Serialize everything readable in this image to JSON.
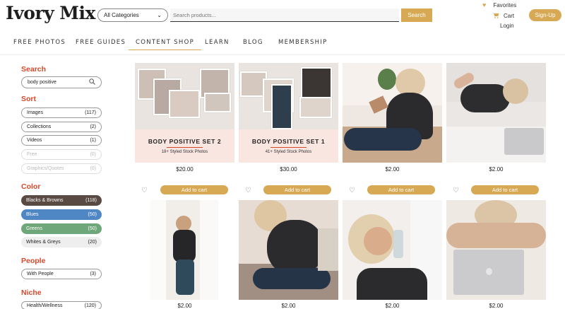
{
  "header": {
    "logo": "Ivory Mix",
    "category_select": "All Categories",
    "search_placeholder": "Search products...",
    "search_button": "Search",
    "favorites": "Favorites",
    "cart": "Cart",
    "login": "Login",
    "signup": "Sign-Up"
  },
  "nav": [
    "FREE PHOTOS",
    "FREE GUIDES",
    "CONTENT SHOP",
    "LEARN",
    "BLOG",
    "MEMBERSHIP"
  ],
  "sidebar": {
    "search_heading": "Search",
    "search_value": "body positive",
    "sort_heading": "Sort",
    "sort": [
      {
        "label": "Images",
        "count": "(117)"
      },
      {
        "label": "Collections",
        "count": "(2)"
      },
      {
        "label": "Videos",
        "count": "(1)"
      },
      {
        "label": "Free",
        "count": "(0)"
      },
      {
        "label": "Graphics/Quotes",
        "count": "(0)"
      }
    ],
    "color_heading": "Color",
    "colors": [
      {
        "label": "Blacks & Browns",
        "count": "(118)",
        "color": "#5a4a44"
      },
      {
        "label": "Blues",
        "count": "(50)",
        "color": "#4f86c4"
      },
      {
        "label": "Greens",
        "count": "(50)",
        "color": "#6ea779"
      },
      {
        "label": "Whites & Greys",
        "count": "(20)",
        "color": "#eeeeee"
      }
    ],
    "people_heading": "People",
    "people": [
      {
        "label": "With People",
        "count": "(3)"
      }
    ],
    "niche_heading": "Niche",
    "niche": [
      {
        "label": "Health/Wellness",
        "count": "(120)"
      }
    ]
  },
  "products": {
    "set2": {
      "title": "BODY POSITIVE SET 2",
      "subtitle": "18+ Styled Stock Photos",
      "price": "$20.00"
    },
    "set1": {
      "title": "BODY POSITIVE SET 1",
      "subtitle": "41+ Styled Stock Photos",
      "price": "$30.00"
    },
    "row1_prices": [
      "$2.00",
      "$2.00"
    ],
    "add_to_cart": "Add to cart",
    "row2_prices": [
      "$2.00",
      "$2.00",
      "$2.00",
      "$2.00"
    ]
  },
  "icons": {
    "heart": "heart-icon",
    "cart": "cart-icon",
    "search": "search-icon",
    "chevron": "chevron-down-icon"
  },
  "colors": {
    "accent": "#d8a954",
    "heading_red": "#d7482b"
  }
}
